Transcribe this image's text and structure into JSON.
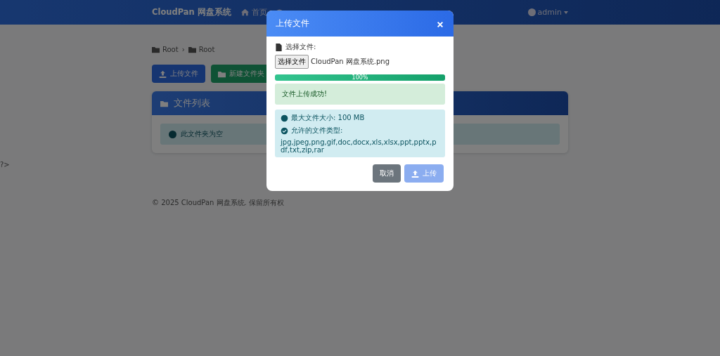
{
  "navbar": {
    "brand": "CloudPan 网盘系统",
    "items": [
      {
        "label": "首页"
      }
    ],
    "user": "admin"
  },
  "breadcrumb": [
    "Root",
    "Root"
  ],
  "breadcrumb_separator": "›",
  "actions": [
    {
      "label": "上传文件",
      "kind": "primary"
    },
    {
      "label": "新建文件夹",
      "kind": "success"
    }
  ],
  "file_list": {
    "title": "文件列表",
    "empty_message": "此文件夹为空"
  },
  "stray_text": "?>",
  "footer": "© 2025 CloudPan 网盘系统. 保留所有权",
  "modal": {
    "title": "上传文件",
    "file_label": "选择文件:",
    "choose_button": "选择文件",
    "file_name": "CloudPan 网盘系统.png",
    "progress": {
      "level": 1,
      "label": "100%"
    },
    "success_message": "文件上传成功!",
    "info": {
      "max_size": "最大文件大小: 100 MB",
      "types_label": "允许的文件类型:",
      "types": "jpg,jpeg,png,gif,doc,docx,xls,xlsx,ppt,pptx,pdf,txt,zip,rar"
    },
    "buttons": [
      {
        "label": "取消",
        "kind": "secondary",
        "disabled": false
      },
      {
        "label": "上传",
        "kind": "primary",
        "disabled": true
      }
    ]
  }
}
